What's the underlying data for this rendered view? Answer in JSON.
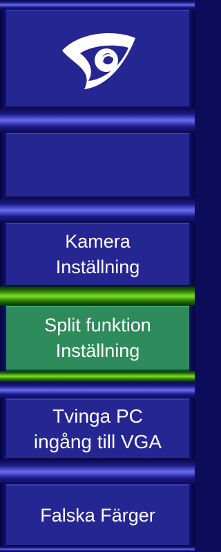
{
  "menu": {
    "logo_icon": "eye-icon",
    "blank_label": "",
    "items": [
      {
        "lines": [
          "Kamera",
          "Inställning"
        ],
        "selected": false
      },
      {
        "lines": [
          "Split funktion",
          "Inställning"
        ],
        "selected": true
      },
      {
        "lines": [
          "Tvinga PC",
          "ingång till VGA"
        ],
        "selected": false
      },
      {
        "lines": [
          "Falska Färger"
        ],
        "selected": false
      }
    ]
  },
  "colors": {
    "background": "#0c0c5a",
    "button": "#262693",
    "selected_button": "#2e8c5c",
    "divider_glow": "#6a6aee",
    "selected_divider_glow": "#7ee21a",
    "text": "#ffffff"
  }
}
